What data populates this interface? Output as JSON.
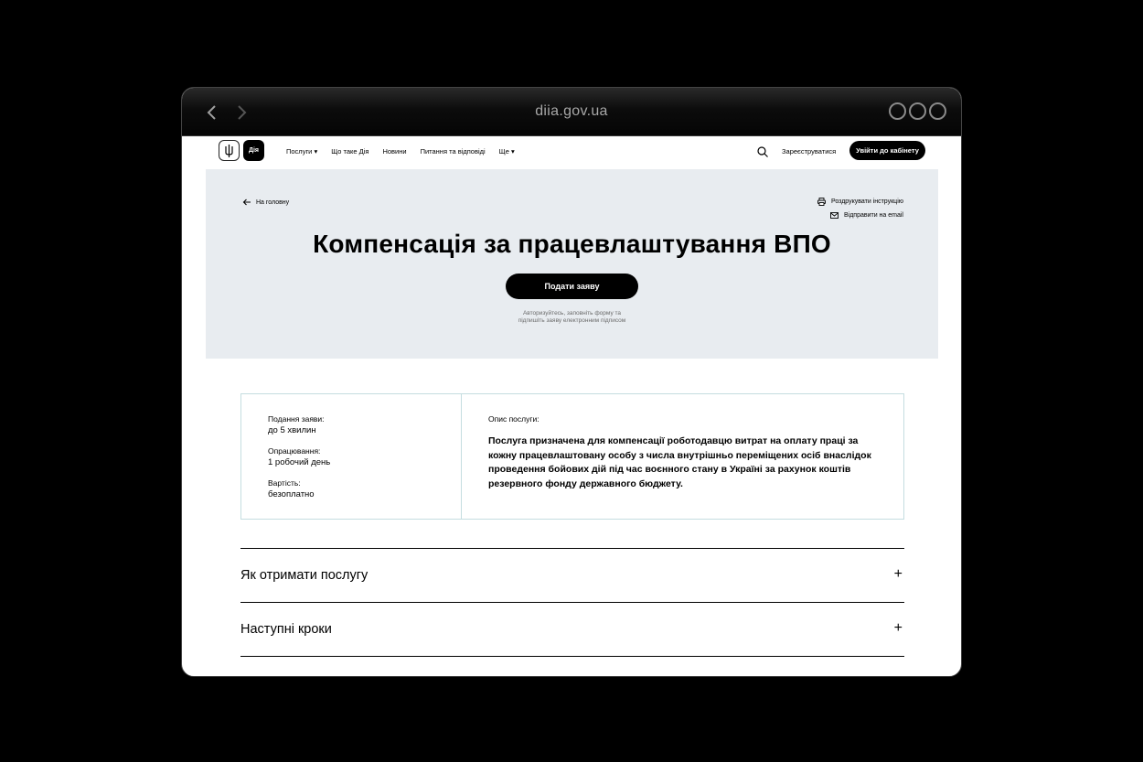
{
  "browser": {
    "url": "diia.gov.ua",
    "back_icon": "chevron-left-icon",
    "forward_icon": "chevron-right-icon"
  },
  "header": {
    "logo_text": "Дія",
    "menu": [
      {
        "label": "Послуги ▾"
      },
      {
        "label": "Що таке Дія"
      },
      {
        "label": "Новини"
      },
      {
        "label": "Питання та відповіді"
      },
      {
        "label": "Ще ▾"
      }
    ],
    "register_label": "Зареєструватися",
    "login_label": "Увійти до кабінету"
  },
  "hero": {
    "back_label": "На головну",
    "print_label": "Роздрукувати інструкцію",
    "email_label": "Відправити на email",
    "title": "Компенсація за працевлаштування ВПО",
    "apply_label": "Подати заяву",
    "hint_line1": "Авторизуйтесь, заповніть форму та",
    "hint_line2": "підпишіть заяву електронним підписом"
  },
  "info": {
    "items": [
      {
        "label": "Подання заяви:",
        "value": "до 5 хвилин"
      },
      {
        "label": "Опрацювання:",
        "value": "1 робочий день"
      },
      {
        "label": "Вартість:",
        "value": "безоплатно"
      }
    ],
    "description_label": "Опис послуги:",
    "description": "Послуга призначена для компенсації роботодавцю витрат на оплату праці за кожну працевлаштовану особу з числа внутрішньо переміщених осіб внаслідок проведення бойових дій під час воєнного стану в Україні за рахунок коштів резервного фонду державного бюджету."
  },
  "accordion": [
    {
      "title": "Як отримати послугу",
      "icon": "+"
    },
    {
      "title": "Наступні кроки",
      "icon": "+"
    }
  ],
  "colors": {
    "hero_bg": "#e8ecf0",
    "info_border": "#c4dde0",
    "primary": "#000000"
  }
}
